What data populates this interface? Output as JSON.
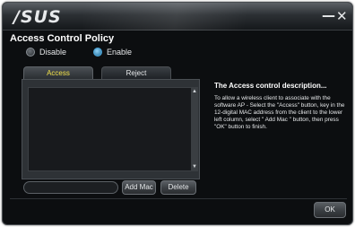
{
  "window": {
    "logo_text": "/SUS",
    "minimize_symbol": "—",
    "close_symbol": "✕"
  },
  "policy": {
    "title": "Access Control Policy",
    "options": [
      {
        "label": "Disable",
        "selected": false
      },
      {
        "label": "Enable",
        "selected": true
      }
    ]
  },
  "tabs": [
    {
      "label": "Access",
      "active": true
    },
    {
      "label": "Reject",
      "active": false
    }
  ],
  "mac_list": {
    "items": [],
    "input_value": "",
    "add_button": "Add Mac",
    "delete_button": "Delete"
  },
  "description": {
    "title": "The Access control description...",
    "body": "To allow a wireless client to associate with the software AP - Select the \"Access\" button, key in the 12-digital MAC address from the client to the lower left column, select \" Add Mac \" button, then press \"OK\" button to finish."
  },
  "footer": {
    "ok_button": "OK"
  },
  "colors": {
    "active_tab_text": "#f0e04a",
    "radio_selected": "#4aa3d6"
  }
}
